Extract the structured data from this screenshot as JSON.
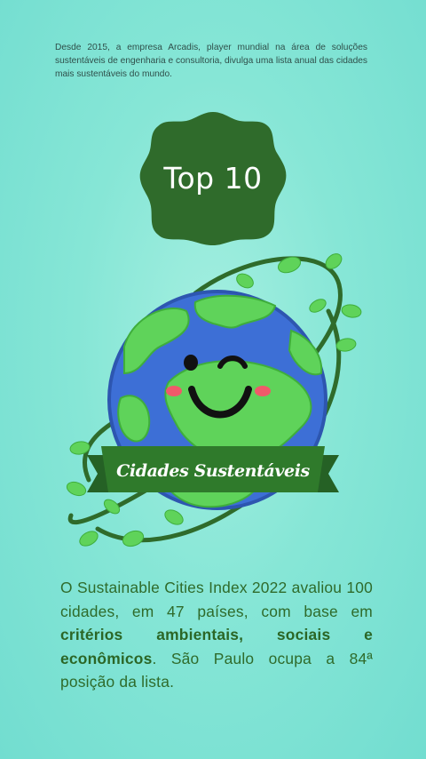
{
  "intro": {
    "text": "Desde 2015, a empresa Arcadis, player mundial na área de soluções sustentáveis de engenharia e consultoria, divulga uma lista anual das cidades mais sustentáveis do mundo."
  },
  "badge": {
    "label": "Top 10"
  },
  "illustration": {
    "banner_label": "Cidades Sustentáveis"
  },
  "body": {
    "part1": "O Sustainable Cities Index 2022 avaliou 100 cidades, em 47 países, com base em ",
    "bold": "critérios ambientais, sociais e econômicos",
    "part2": ". São Paulo ocupa a 84ª posição da lista."
  },
  "colors": {
    "background": "#86e6d6",
    "badge": "#2f6b2b",
    "leaf": "#5fd35a",
    "ocean": "#3d6fd6",
    "body_text": "#2f6b2b"
  }
}
